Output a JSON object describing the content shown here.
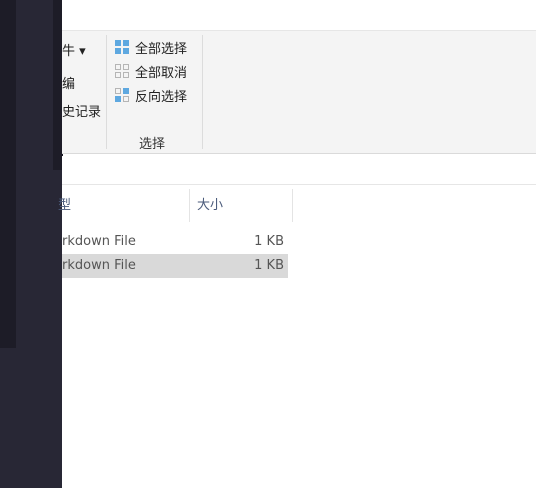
{
  "ribbon": {
    "left_items": [
      "牛 ▾",
      "编",
      "史记录"
    ],
    "select_group": {
      "items": [
        {
          "label": "全部选择",
          "icon": "select-all-icon"
        },
        {
          "label": "全部取消",
          "icon": "select-none-icon"
        },
        {
          "label": "反向选择",
          "icon": "invert-selection-icon"
        }
      ],
      "group_label": "选择"
    }
  },
  "columns": {
    "type": "型",
    "size": "大小"
  },
  "files": [
    {
      "type": "rkdown File",
      "size": "1 KB",
      "selected": false
    },
    {
      "type": "rkdown File",
      "size": "1 KB",
      "selected": true
    }
  ],
  "colors": {
    "dark_panel": "#282735",
    "ribbon_bg": "#f4f4f4",
    "selection": "#d9d9d9",
    "header_text": "#4a5a7a"
  }
}
